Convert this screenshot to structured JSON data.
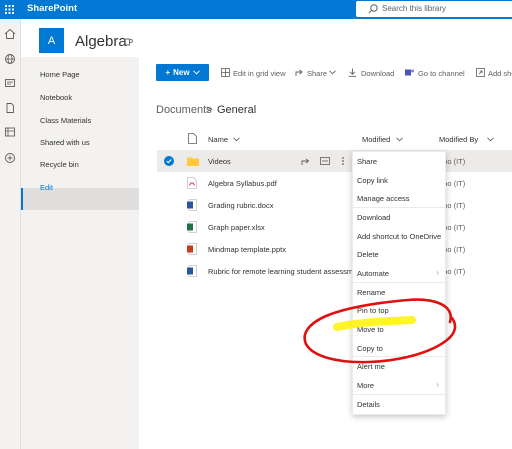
{
  "suite": {
    "app_name": "SharePoint",
    "search_placeholder": "Search this library"
  },
  "site": {
    "logo_letter": "A",
    "title": "Algebra"
  },
  "leftnav": {
    "items": [
      "Home Page",
      "Notebook",
      "Class Materials",
      "Shared with us",
      "Recycle bin",
      "Edit"
    ],
    "active": "Shared with us"
  },
  "commandbar": {
    "new_label": "New",
    "items": [
      "Edit in grid view",
      "Share",
      "Download",
      "Go to channel",
      "Add sho"
    ]
  },
  "breadcrumb": {
    "parent": "Documents",
    "separator": ">",
    "current": "General"
  },
  "list": {
    "columns": {
      "name": "Name",
      "modified": "Modified",
      "modified_by": "Modified By"
    },
    "rows": [
      {
        "name": "Videos",
        "type": "folder",
        "modified_by": "uno (IT)",
        "selected": true
      },
      {
        "name": "Algebra Syllabus.pdf",
        "type": "pdf",
        "modified_by": "uno (IT)"
      },
      {
        "name": "Grading rubric.docx",
        "type": "word",
        "modified_by": "uno (IT)"
      },
      {
        "name": "Graph paper.xlsx",
        "type": "excel",
        "modified_by": "uno (IT)"
      },
      {
        "name": "Mindmap template.pptx",
        "type": "powerpoint",
        "modified_by": "uno (IT)"
      },
      {
        "name": "Rubric for remote learning student assessm...",
        "type": "word",
        "modified_by": "uno (IT)"
      }
    ]
  },
  "context_menu": {
    "items": [
      "Share",
      "Copy link",
      "Manage access",
      "Download",
      "Add shortcut to OneDrive",
      "Delete",
      "Automate",
      "Rename",
      "Pin to top",
      "Move to",
      "Copy to",
      "Alert me",
      "More",
      "Details"
    ],
    "highlighted": "Move to"
  },
  "colors": {
    "brand": "#0078d4",
    "highlight": "#fff200",
    "annotation": "#e01010"
  }
}
